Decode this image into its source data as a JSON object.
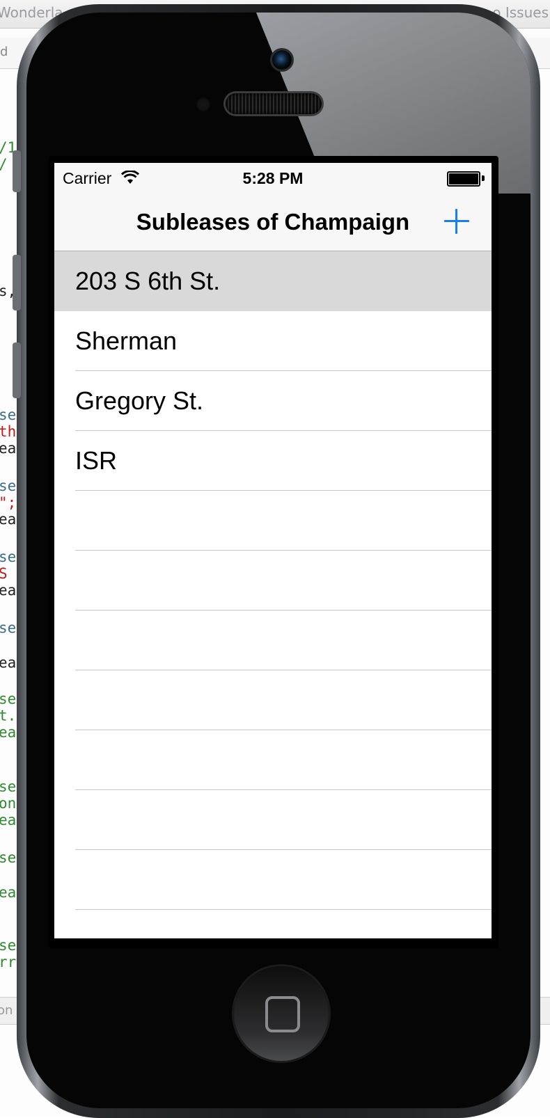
{
  "background": {
    "window_title_left": "Wonderla",
    "window_title_right": "o Issues",
    "jump_bar_text": "d",
    "bottom_bar_text": "on",
    "code_fragments": [
      {
        "text": "/1",
        "color": "#2e8b2e"
      },
      {
        "text": " /",
        "color": "#2e8b2e"
      },
      {
        "text": "s,",
        "color": "#222222"
      },
      {
        "text": "se",
        "color": "#3c6e8a"
      },
      {
        "text": "th",
        "color": "#c41a16"
      },
      {
        "text": "ea",
        "color": "#222222"
      },
      {
        "text": "se",
        "color": "#3c6e8a"
      },
      {
        "text": "\";",
        "color": "#c41a16"
      },
      {
        "text": "ea",
        "color": "#222222"
      },
      {
        "text": "se",
        "color": "#3c6e8a"
      },
      {
        "text": " S",
        "color": "#c41a16"
      },
      {
        "text": "ea",
        "color": "#222222"
      },
      {
        "text": "se",
        "color": "#3c6e8a"
      },
      {
        "text": "ea",
        "color": "#222222"
      },
      {
        "text": "se",
        "color": "#2e8b2e"
      },
      {
        "text": "t.",
        "color": "#2e8b2e"
      },
      {
        "text": "ea",
        "color": "#2e8b2e"
      },
      {
        "text": "se",
        "color": "#2e8b2e"
      },
      {
        "text": "on",
        "color": "#2e8b2e"
      },
      {
        "text": "ea",
        "color": "#2e8b2e"
      },
      {
        "text": "se",
        "color": "#2e8b2e"
      },
      {
        "text": "ea",
        "color": "#2e8b2e"
      },
      {
        "text": "se",
        "color": "#2e8b2e"
      },
      {
        "text": "rr",
        "color": "#2e8b2e"
      }
    ]
  },
  "status_bar": {
    "carrier": "Carrier",
    "wifi_icon": "wifi-icon",
    "time": "5:28 PM",
    "battery_icon": "battery-full-icon"
  },
  "nav_bar": {
    "title": "Subleases of Champaign",
    "add_icon": "plus-icon",
    "accent_color": "#157efb"
  },
  "table": {
    "rows": [
      {
        "label": "203 S 6th St.",
        "selected": true
      },
      {
        "label": "Sherman",
        "selected": false
      },
      {
        "label": "Gregory St.",
        "selected": false
      },
      {
        "label": "ISR",
        "selected": false
      },
      {
        "label": "",
        "selected": false
      },
      {
        "label": "",
        "selected": false
      },
      {
        "label": "",
        "selected": false
      },
      {
        "label": "",
        "selected": false
      },
      {
        "label": "",
        "selected": false
      },
      {
        "label": "",
        "selected": false
      },
      {
        "label": "",
        "selected": false
      }
    ],
    "selected_color": "#d9d9d9"
  },
  "device": {
    "home_button_icon": "home-square-icon"
  }
}
